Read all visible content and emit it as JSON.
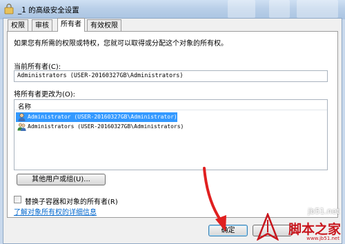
{
  "window": {
    "title": "_1 的高级安全设置"
  },
  "tabs": [
    {
      "label": "权限"
    },
    {
      "label": "审核"
    },
    {
      "label": "所有者"
    },
    {
      "label": "有效权限"
    }
  ],
  "panel": {
    "description": "如果您有所需的权限或特权，您就可以取得或分配这个对象的所有权。",
    "current_owner_label": "当前所有者(C):",
    "current_owner_value": "Administrators (USER-20160327GB\\Administrators)",
    "change_owner_label": "将所有者更改为(O):",
    "list_header": "名称",
    "owners": [
      {
        "name": "Administrator (USER-20160327GB\\Administrator)",
        "selected": true
      },
      {
        "name": "Administrators (USER-20160327GB\\Administrators)",
        "selected": false
      }
    ],
    "other_users_button": "其他用户或组(U)...",
    "replace_checkbox_label": "替换子容器和对象的所有者(R)",
    "replace_checked": false,
    "learn_more_link": "了解对象所有权的详细信息"
  },
  "footer": {
    "ok_button": "确定"
  },
  "watermark": {
    "site": "jb51.net",
    "brand": "脚本之家",
    "url": "www.jb51.net"
  },
  "colors": {
    "selection": "#3399ff",
    "link": "#0066cc",
    "arrow": "#e02020",
    "watermark": "#c8161d"
  }
}
